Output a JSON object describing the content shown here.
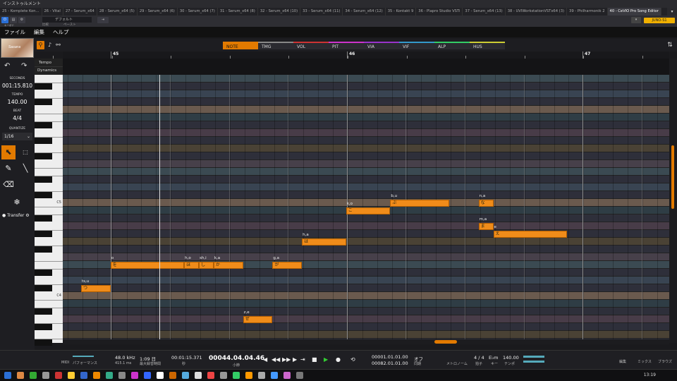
{
  "window": {
    "title": "インストゥルメント"
  },
  "plugin_tabs": [
    "25 - Komplete Kon...",
    "26 - Vital",
    "27 - Serum_x64",
    "28 - Serum_x64 (5)",
    "29 - Serum_x64 (6)",
    "30 - Serum_x64 (7)",
    "31 - Serum_x64 (8)",
    "32 - Serum_x64 (10)",
    "33 - Serum_x64 (11)",
    "34 - Serum_x64 (12)",
    "35 - Kontakt 9",
    "36 - Plapro Studio VSTi",
    "37 - Serum_x64 (13)",
    "38 - UVIWorkstationVSTx64 (3)",
    "39 - Philharmonik 2",
    "40 - CeVIO Pro Song Editor"
  ],
  "plugin_bar": {
    "preset": "デフォルト",
    "compare": "比較",
    "copy": "コピー",
    "paste": "ペースト",
    "plugin_name": "JUNO-S1"
  },
  "menu": [
    "ファイル",
    "編集",
    "ヘルプ"
  ],
  "singer": {
    "name": "Sasara"
  },
  "sidebar": {
    "seconds_label": "SECONDS",
    "seconds_value": "001:15.810",
    "tempo_label": "TEMPO",
    "tempo_value": "140.00",
    "beat_label": "BEAT",
    "beat_value": "4/4",
    "quantize_label": "QUANTIZE",
    "quantize_value": "1/16",
    "transfer_label": "Transfer"
  },
  "mode_tabs": [
    {
      "label": "NOTE",
      "color": "#e27a00"
    },
    {
      "label": "TMG",
      "color": "#888"
    },
    {
      "label": "VOL",
      "color": "#c33"
    },
    {
      "label": "PIT",
      "color": "#c3c"
    },
    {
      "label": "VIA",
      "color": "#93c"
    },
    {
      "label": "VIF",
      "color": "#39c"
    },
    {
      "label": "ALP",
      "color": "#3c6"
    },
    {
      "label": "HUS",
      "color": "#cc3"
    }
  ],
  "ruler": {
    "bars": [
      "45",
      "46",
      "47"
    ]
  },
  "lanes": {
    "tempo": "Tempo",
    "dynamics": "Dynamics"
  },
  "piano": {
    "c5": "C5",
    "c4": "C4"
  },
  "notes": [
    {
      "phoneme": "ts,u",
      "lyric": "つ",
      "start": 0.0,
      "length": 0.125,
      "pitch": "C4+1"
    },
    {
      "phoneme": "o",
      "lyric": "を",
      "start": 0.125,
      "length": 0.3125,
      "pitch": "E4"
    },
    {
      "phoneme": "h,o",
      "lyric": "ほ",
      "start": 0.4375,
      "length": 0.0625,
      "pitch": "E4"
    },
    {
      "phoneme": "sh,i",
      "lyric": "し",
      "start": 0.5,
      "length": 0.0625,
      "pitch": "E4"
    },
    {
      "phoneme": "k,a",
      "lyric": "か",
      "start": 0.5625,
      "length": 0.125,
      "pitch": "E4"
    },
    {
      "phoneme": "z,e",
      "lyric": "ぜ",
      "start": 0.6875,
      "length": 0.125,
      "pitch": "A3"
    },
    {
      "phoneme": "g,a",
      "lyric": "が",
      "start": 0.8125,
      "length": 0.125,
      "pitch": "E4"
    },
    {
      "phoneme": "h,a",
      "lyric": "は",
      "start": 0.9375,
      "length": 0.1875,
      "pitch": "G4"
    },
    {
      "phoneme": "k,o",
      "lyric": "こ",
      "start": 1.125,
      "length": 0.1875,
      "pitch": "B4"
    },
    {
      "phoneme": "b,u",
      "lyric": "ぶ",
      "start": 1.3125,
      "length": 0.25,
      "pitch": "C5"
    },
    {
      "phoneme": "n,a",
      "lyric": "な",
      "start": 1.6875,
      "length": 0.0625,
      "pitch": "C5"
    },
    {
      "phoneme": "m,a",
      "lyric": "ま",
      "start": 1.6875,
      "length": 0.0625,
      "pitch": "A4"
    },
    {
      "phoneme": "e",
      "lyric": "え",
      "start": 1.75,
      "length": 0.3125,
      "pitch": "G#4"
    }
  ],
  "transport": {
    "midi": "MIDI",
    "perf": "パフォーマンス",
    "sample_rate": "48.0 kHz",
    "latency": "415.1 ms",
    "duration": "1:09 日",
    "rec_max": "最大録音時間",
    "time": "00:01:15.371",
    "time_label": "秒",
    "position": "00044.04.04.46",
    "position_label": "小節",
    "loop_start": "00001.01.01.00",
    "loop_end": "00082.01.01.00",
    "metronome": "オフ",
    "metronome_label": "同期",
    "metronome2": "メトロノーム",
    "signature": "4 / 4",
    "sig_label": "拍子",
    "key": "E♭m",
    "key_label": "キー",
    "tempo": "140.00",
    "tempo_label": "テンポ",
    "edit": "編集",
    "mix": "ミックス",
    "browse": "ブラウズ"
  },
  "taskbar": {
    "clock": "13:19"
  }
}
